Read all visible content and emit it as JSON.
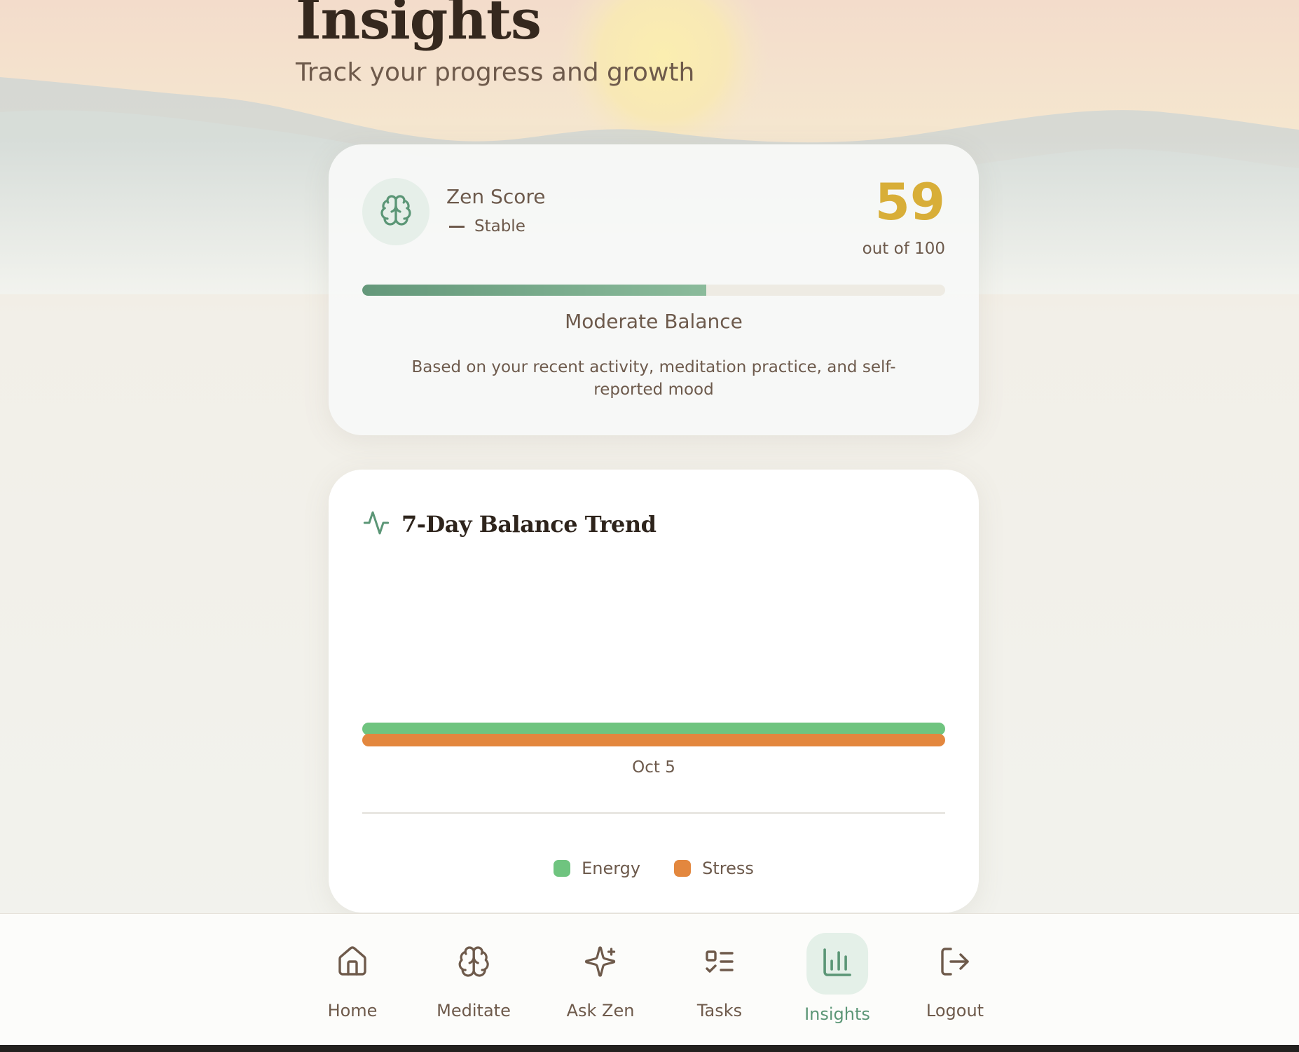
{
  "page": {
    "title": "Insights",
    "subtitle": "Track your progress and growth"
  },
  "zen_score": {
    "label": "Zen Score",
    "trend": "Stable",
    "score": "59",
    "score_caption": "out of 100",
    "progress_fraction": 0.59,
    "balance_label": "Moderate Balance",
    "description": "Based on your recent activity, meditation practice, and self-reported mood"
  },
  "trend_card": {
    "title": "7-Day Balance Trend",
    "icon": "activity-icon"
  },
  "chart_data": {
    "type": "bar",
    "categories": [
      "Oct 5"
    ],
    "series": [
      {
        "name": "Energy",
        "values": [
          1
        ],
        "color": "#6fc47f"
      },
      {
        "name": "Stress",
        "values": [
          1
        ],
        "color": "#e3873e"
      }
    ],
    "legend_position": "bottom"
  },
  "nav": {
    "items": [
      {
        "label": "Home",
        "icon": "home-icon",
        "active": false
      },
      {
        "label": "Meditate",
        "icon": "brain-icon",
        "active": false
      },
      {
        "label": "Ask Zen",
        "icon": "sparkles-icon",
        "active": false
      },
      {
        "label": "Tasks",
        "icon": "tasks-icon",
        "active": false
      },
      {
        "label": "Insights",
        "icon": "bar-chart-icon",
        "active": true
      },
      {
        "label": "Logout",
        "icon": "logout-icon",
        "active": false
      }
    ]
  },
  "colors": {
    "accent": "#5b9676",
    "score": "#d8ae38",
    "energy": "#6fc47f",
    "stress": "#e3873e"
  }
}
